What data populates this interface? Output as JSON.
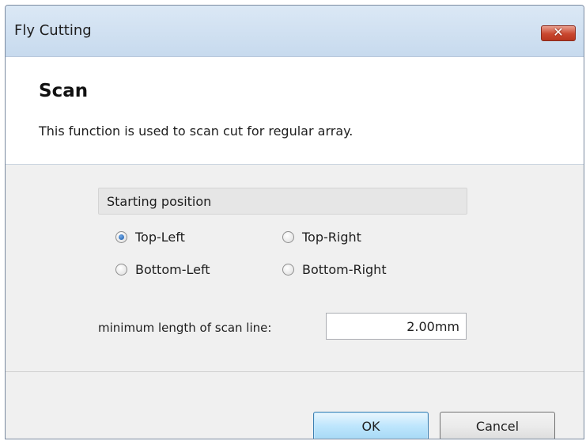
{
  "window": {
    "title": "Fly Cutting",
    "close_label": "✕"
  },
  "header": {
    "title": "Scan",
    "description": "This function is used to scan cut for regular array."
  },
  "starting_position": {
    "group_label": "Starting position",
    "options": [
      {
        "label": "Top-Left",
        "checked": true
      },
      {
        "label": "Top-Right",
        "checked": false
      },
      {
        "label": "Bottom-Left",
        "checked": false
      },
      {
        "label": "Bottom-Right",
        "checked": false
      }
    ]
  },
  "min_length": {
    "label": "minimum length of scan line:",
    "value": "2.00mm"
  },
  "footer": {
    "ok_label": "OK",
    "cancel_label": "Cancel"
  },
  "colors": {
    "titlebar": "#c7daee",
    "close_button": "#c9472f",
    "ok_border": "#3c7fb1"
  }
}
